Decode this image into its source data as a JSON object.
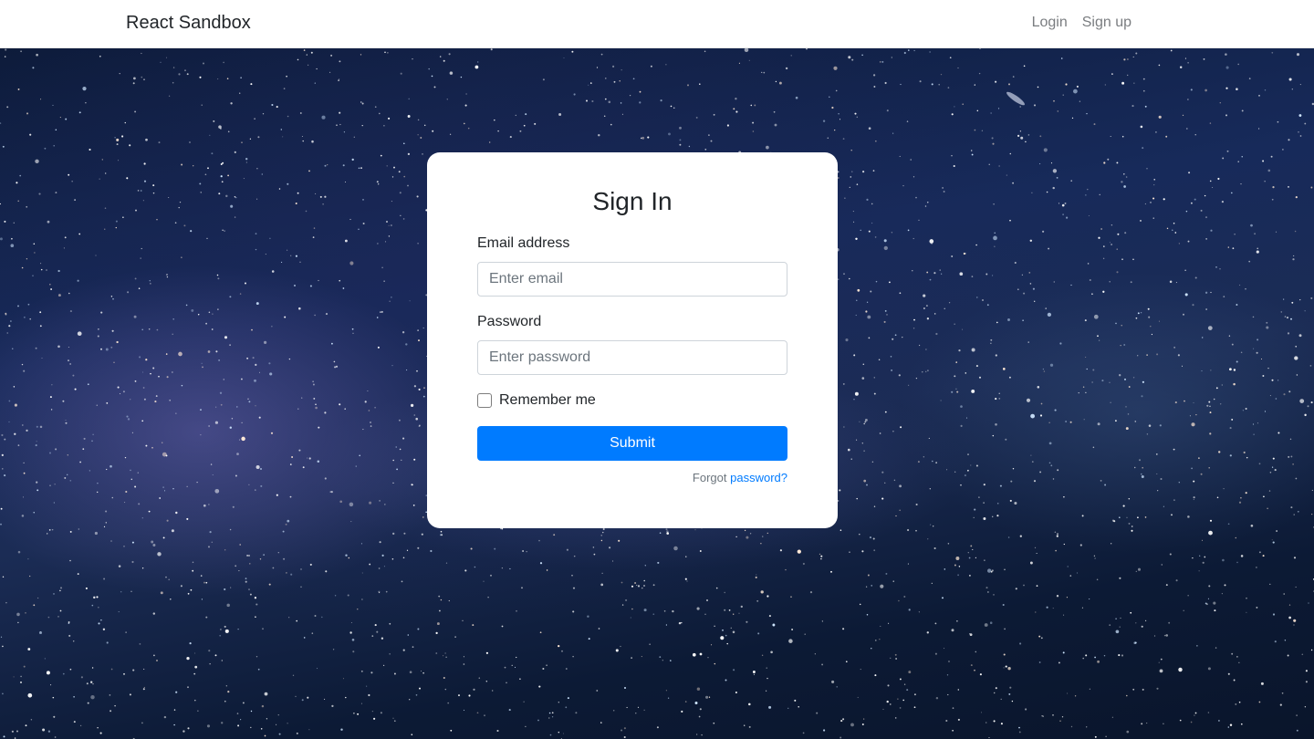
{
  "navbar": {
    "brand": "React Sandbox",
    "links": [
      {
        "label": "Login"
      },
      {
        "label": "Sign up"
      }
    ]
  },
  "signin": {
    "title": "Sign In",
    "email_label": "Email address",
    "email_placeholder": "Enter email",
    "email_value": "",
    "password_label": "Password",
    "password_placeholder": "Enter password",
    "password_value": "",
    "remember_label": "Remember me",
    "remember_checked": false,
    "submit_label": "Submit",
    "forgot_prefix": "Forgot",
    "forgot_link": "password?"
  },
  "colors": {
    "accent": "#007bff",
    "navbar_bg": "#ffffff",
    "card_bg": "#ffffff",
    "background": "#172a5a"
  },
  "background": {
    "kind": "starfield"
  }
}
